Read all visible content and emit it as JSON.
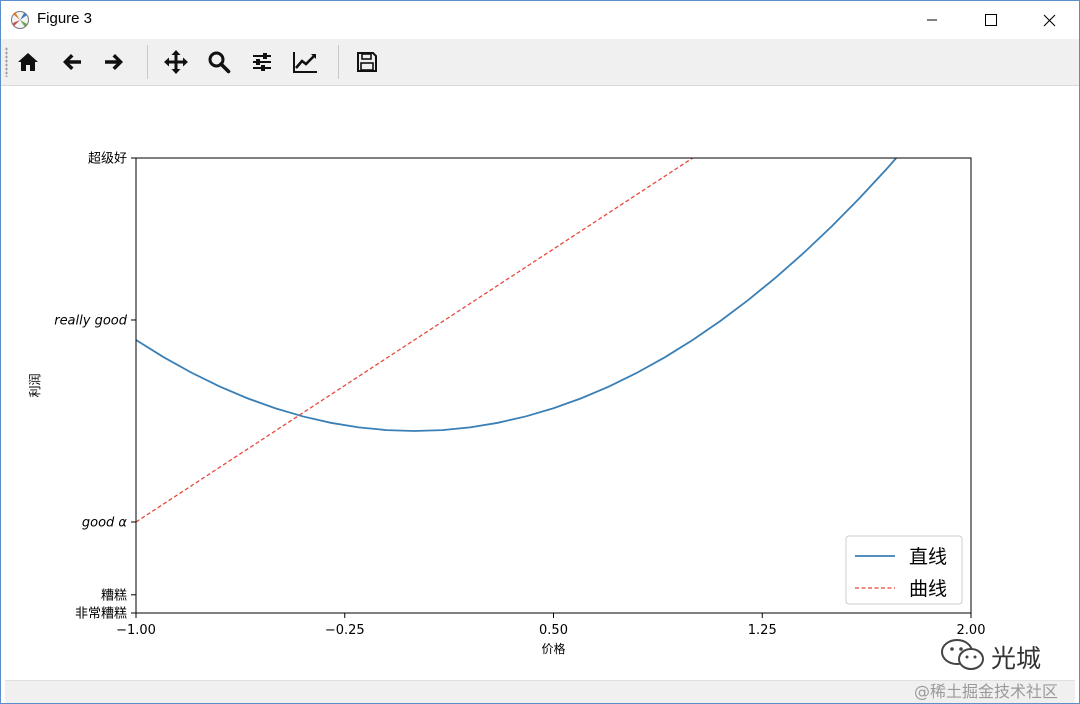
{
  "window": {
    "title": "Figure 3",
    "controls": {
      "minimize": "—",
      "maximize": "☐",
      "close": "✕"
    }
  },
  "toolbar": {
    "buttons": [
      {
        "name": "home",
        "icon": "home-icon"
      },
      {
        "name": "back",
        "icon": "arrow-left-icon"
      },
      {
        "name": "forward",
        "icon": "arrow-right-icon"
      },
      {
        "name": "pan",
        "icon": "move-icon"
      },
      {
        "name": "zoom",
        "icon": "magnifier-icon"
      },
      {
        "name": "configure-subplots",
        "icon": "sliders-icon"
      },
      {
        "name": "edit-axes",
        "icon": "line-chart-icon"
      },
      {
        "name": "save",
        "icon": "floppy-icon"
      }
    ]
  },
  "chart_data": {
    "type": "line",
    "xlabel": "价格",
    "ylabel": "利润",
    "xlim": [
      -1.0,
      2.0
    ],
    "ylim": [
      -2.0,
      3.0
    ],
    "xticks": [
      -1.0,
      -0.25,
      0.5,
      1.25,
      2.0
    ],
    "xtick_labels": [
      "−1.00",
      "−0.25",
      "0.50",
      "1.25",
      "2.00"
    ],
    "yticks": [
      -2.0,
      -1.8,
      -1.0,
      1.22,
      3.0
    ],
    "ytick_labels": [
      "非常糟糕",
      "糟糕",
      "good α",
      "really good",
      "超级好"
    ],
    "ytick_italic": [
      false,
      false,
      true,
      true,
      false
    ],
    "grid": false,
    "legend_position": "lower right",
    "series": [
      {
        "name": "直线",
        "style": "solid",
        "color": "#3a7fb5",
        "x": [
          -1.0,
          -0.9,
          -0.8,
          -0.7,
          -0.6,
          -0.5,
          -0.4,
          -0.3,
          -0.2,
          -0.1,
          0.0,
          0.1,
          0.2,
          0.3,
          0.4,
          0.5,
          0.6,
          0.7,
          0.8,
          0.9,
          1.0,
          1.1,
          1.2,
          1.3,
          1.4,
          1.5,
          1.6,
          1.7,
          1.8
        ],
        "y": [
          1.0,
          0.81,
          0.64,
          0.49,
          0.36,
          0.25,
          0.16,
          0.09,
          0.04,
          0.01,
          0.0,
          0.01,
          0.04,
          0.09,
          0.16,
          0.25,
          0.36,
          0.49,
          0.64,
          0.81,
          1.0,
          1.21,
          1.44,
          1.69,
          1.96,
          2.25,
          2.56,
          2.89,
          3.24
        ]
      },
      {
        "name": "曲线",
        "style": "dashed",
        "color": "#e8483b",
        "x": [
          -1.0,
          2.0
        ],
        "y": [
          -1.0,
          5.0
        ]
      }
    ]
  },
  "watermark": {
    "brand": "光城",
    "site": "@稀土掘金技术社区"
  }
}
